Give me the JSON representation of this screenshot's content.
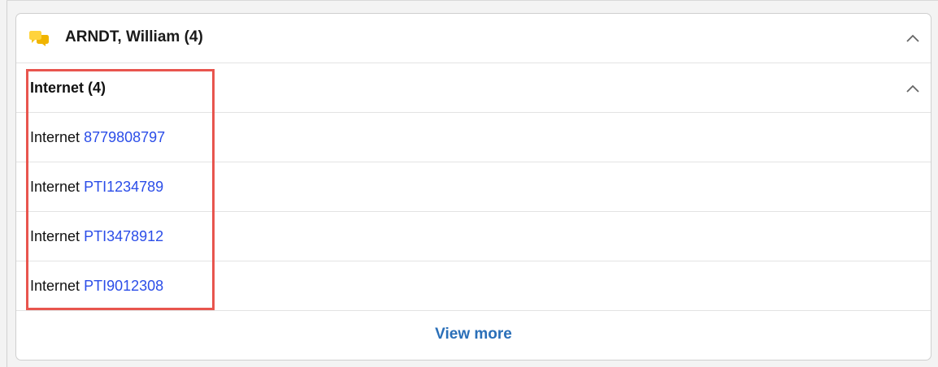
{
  "panel": {
    "title": "ARNDT, William (4)",
    "icon": "chat-bubbles-icon",
    "accent_color": "#f5c518"
  },
  "group": {
    "title": "Internet (4)"
  },
  "items": [
    {
      "type": "Internet",
      "id": "8779808797"
    },
    {
      "type": "Internet",
      "id": "PTI1234789"
    },
    {
      "type": "Internet",
      "id": "PTI3478912"
    },
    {
      "type": "Internet",
      "id": "PTI9012308"
    }
  ],
  "footer": {
    "view_more_label": "View more"
  },
  "colors": {
    "link": "#2b4de8",
    "view_more": "#2a6fb8",
    "highlight": "#e8554e"
  }
}
